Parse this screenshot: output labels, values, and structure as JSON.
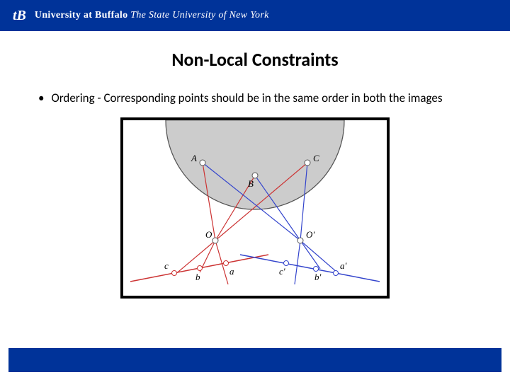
{
  "header": {
    "logo_text": "tB",
    "university_bold": "University at Buffalo",
    "university_italic": "The State University of New York"
  },
  "slide": {
    "title": "Non-Local Constraints",
    "bullet_text": "Ordering -  Corresponding points should be in the same order in both the images"
  },
  "diagram": {
    "labels": {
      "A": "A",
      "B": "B",
      "C": "C",
      "O": "O",
      "Oprime": "O'",
      "a": "a",
      "b": "b",
      "c": "c",
      "aprime": "a'",
      "bprime": "b'",
      "cprime": "c'"
    }
  }
}
